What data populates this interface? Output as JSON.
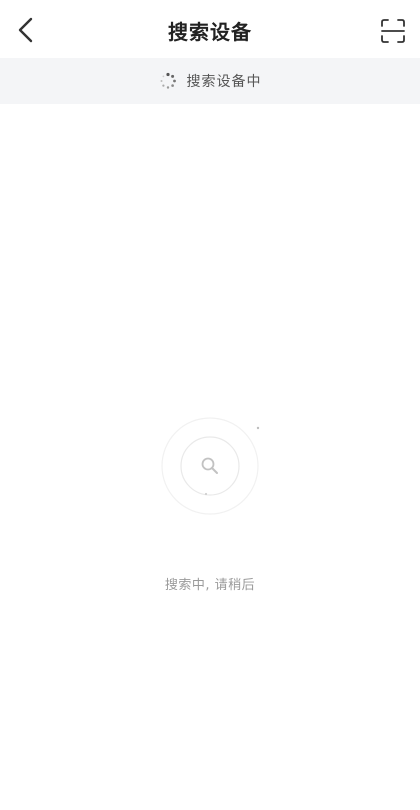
{
  "header": {
    "title": "搜索设备",
    "back_icon": "chevron-left-icon",
    "scan_icon": "scan-icon"
  },
  "status": {
    "text": "搜索设备中",
    "icon": "spinner-icon"
  },
  "main": {
    "hint": "搜索中, 请稍后",
    "radar_icon": "magnifier-icon"
  },
  "colors": {
    "status_bg": "#f4f5f7",
    "text_primary": "#222222",
    "text_secondary": "#9a9a9a"
  }
}
